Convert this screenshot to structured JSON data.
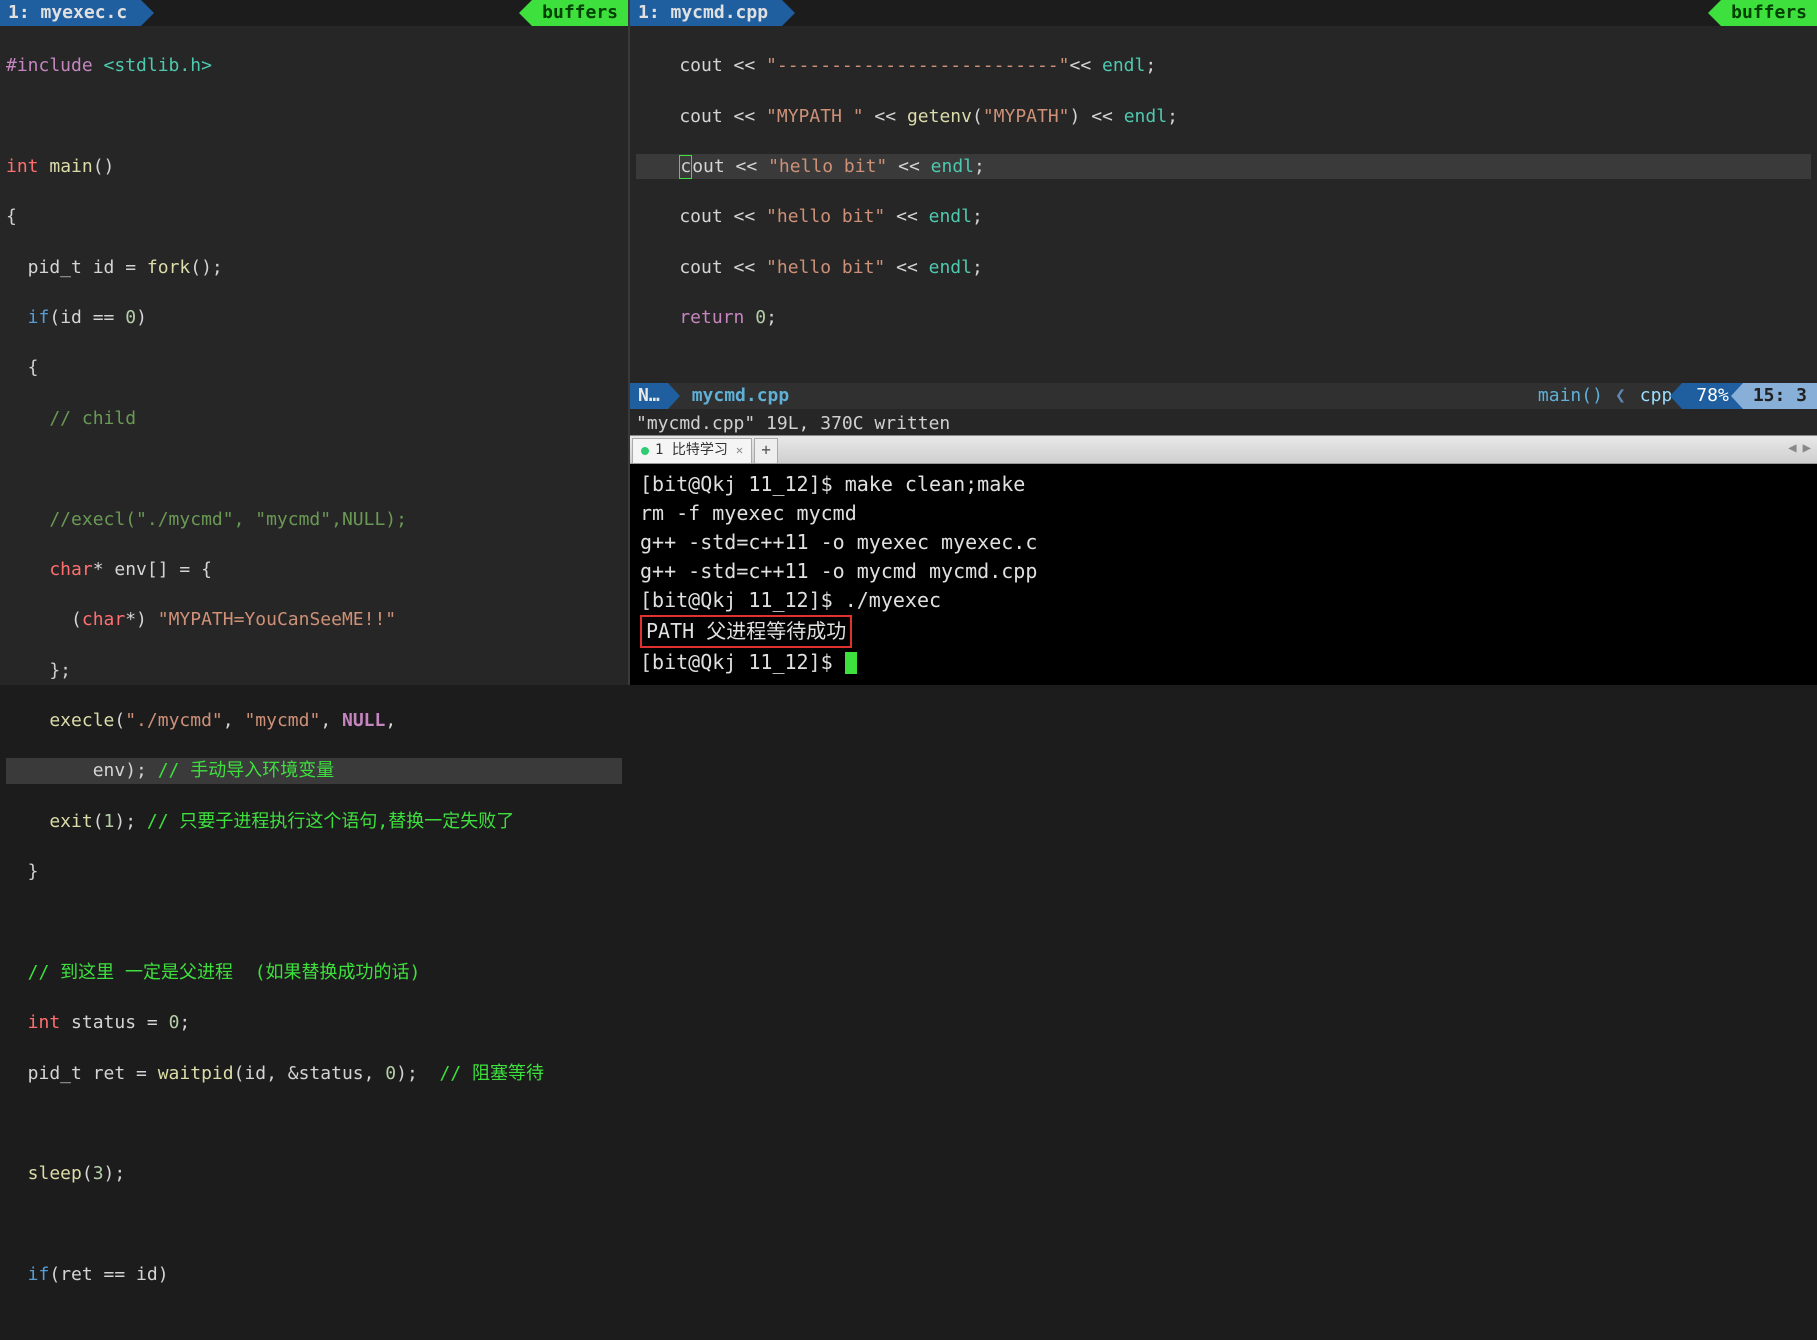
{
  "left": {
    "tab": "1: myexec.c",
    "buffers": "buffers",
    "code": {
      "l1a": "#include",
      "l1b": " <stdlib.h>",
      "l2a": "int",
      "l2b": " main",
      "l2c": "()",
      "l3": "{",
      "l4a": "  pid_t id = ",
      "l4b": "fork",
      "l4c": "();",
      "l5a": "  if",
      "l5b": "(id == ",
      "l5c": "0",
      "l5d": ")",
      "l6": "  {",
      "l7": "    // child",
      "l8": "    //execl(\"./mycmd\", \"mycmd\",NULL);",
      "l9a": "    char",
      "l9b": "* env[] = {",
      "l10a": "      (",
      "l10b": "char",
      "l10c": "*) ",
      "l10d": "\"MYPATH=YouCanSeeME!!\"",
      "l11": "    };",
      "l12a": "    execle",
      "l12b": "(",
      "l12c": "\"./mycmd\"",
      "l12d": ", ",
      "l12e": "\"mycmd\"",
      "l12f": ", ",
      "l12g": "NULL",
      "l12h": ",",
      "l13a": "        env); ",
      "l13b": "// 手动导入环境变量",
      "l14a": "    exit",
      "l14b": "(",
      "l14c": "1",
      "l14d": "); ",
      "l14e": "// 只要子进程执行这个语句,替换一定失败了",
      "l15": "  }",
      "l16": "  // 到这里 一定是父进程  (如果替换成功的话)",
      "l17a": "  int",
      "l17b": " status = ",
      "l17c": "0",
      "l17d": ";",
      "l18a": "  pid_t ret = ",
      "l18b": "waitpid",
      "l18c": "(id, &status, ",
      "l18d": "0",
      "l18e": ");  ",
      "l18f": "// 阻塞等待",
      "l19a": "  sleep",
      "l19b": "(",
      "l19c": "3",
      "l19d": ");",
      "l20a": "  if",
      "l20b": "(ret == id)"
    }
  },
  "right": {
    "tab": "1: mycmd.cpp",
    "buffers": "buffers",
    "code": {
      "l1a": "    cout << ",
      "l1b": "\"--------------------------\"",
      "l1c": "<< ",
      "l1d": "endl",
      "l1e": ";",
      "l2a": "    cout << ",
      "l2b": "\"MYPATH \"",
      "l2c": " << ",
      "l2d": "getenv",
      "l2e": "(",
      "l2f": "\"MYPATH\"",
      "l2g": ") << ",
      "l2h": "endl",
      "l2i": ";",
      "l3a": "    ",
      "l3cur": "c",
      "l3b": "out << ",
      "l3c": "\"hello bit\"",
      "l3d": " << ",
      "l3e": "endl",
      "l3f": ";",
      "l4a": "    cout << ",
      "l4b": "\"hello bit\"",
      "l4c": " << ",
      "l4d": "endl",
      "l4e": ";",
      "l5a": "    cout << ",
      "l5b": "\"hello bit\"",
      "l5c": " << ",
      "l5d": "endl",
      "l5e": ";",
      "l6a": "    return",
      "l6b": " ",
      "l6c": "0",
      "l6d": ";"
    },
    "status": {
      "mode": "N…",
      "file": "mycmd.cpp",
      "func": "main()",
      "sep": "❮",
      "ft": "cpp",
      "pct": "78%",
      "pos": "15:   3"
    },
    "msg": "\"mycmd.cpp\" 19L, 370C written"
  },
  "terminal": {
    "tab_label": "1 比特学习",
    "lines": {
      "p1": "[bit@Qkj 11_12]$ ",
      "c1": "make clean;make",
      "o1": "rm -f myexec mycmd",
      "o2": "g++ -std=c++11 -o myexec myexec.c",
      "o3": "g++ -std=c++11 -o mycmd mycmd.cpp",
      "p2": "[bit@Qkj 11_12]$ ",
      "c2": "./myexec",
      "boxed": "PATH 父进程等待成功",
      "p3": "[bit@Qkj 11_12]$ "
    }
  }
}
